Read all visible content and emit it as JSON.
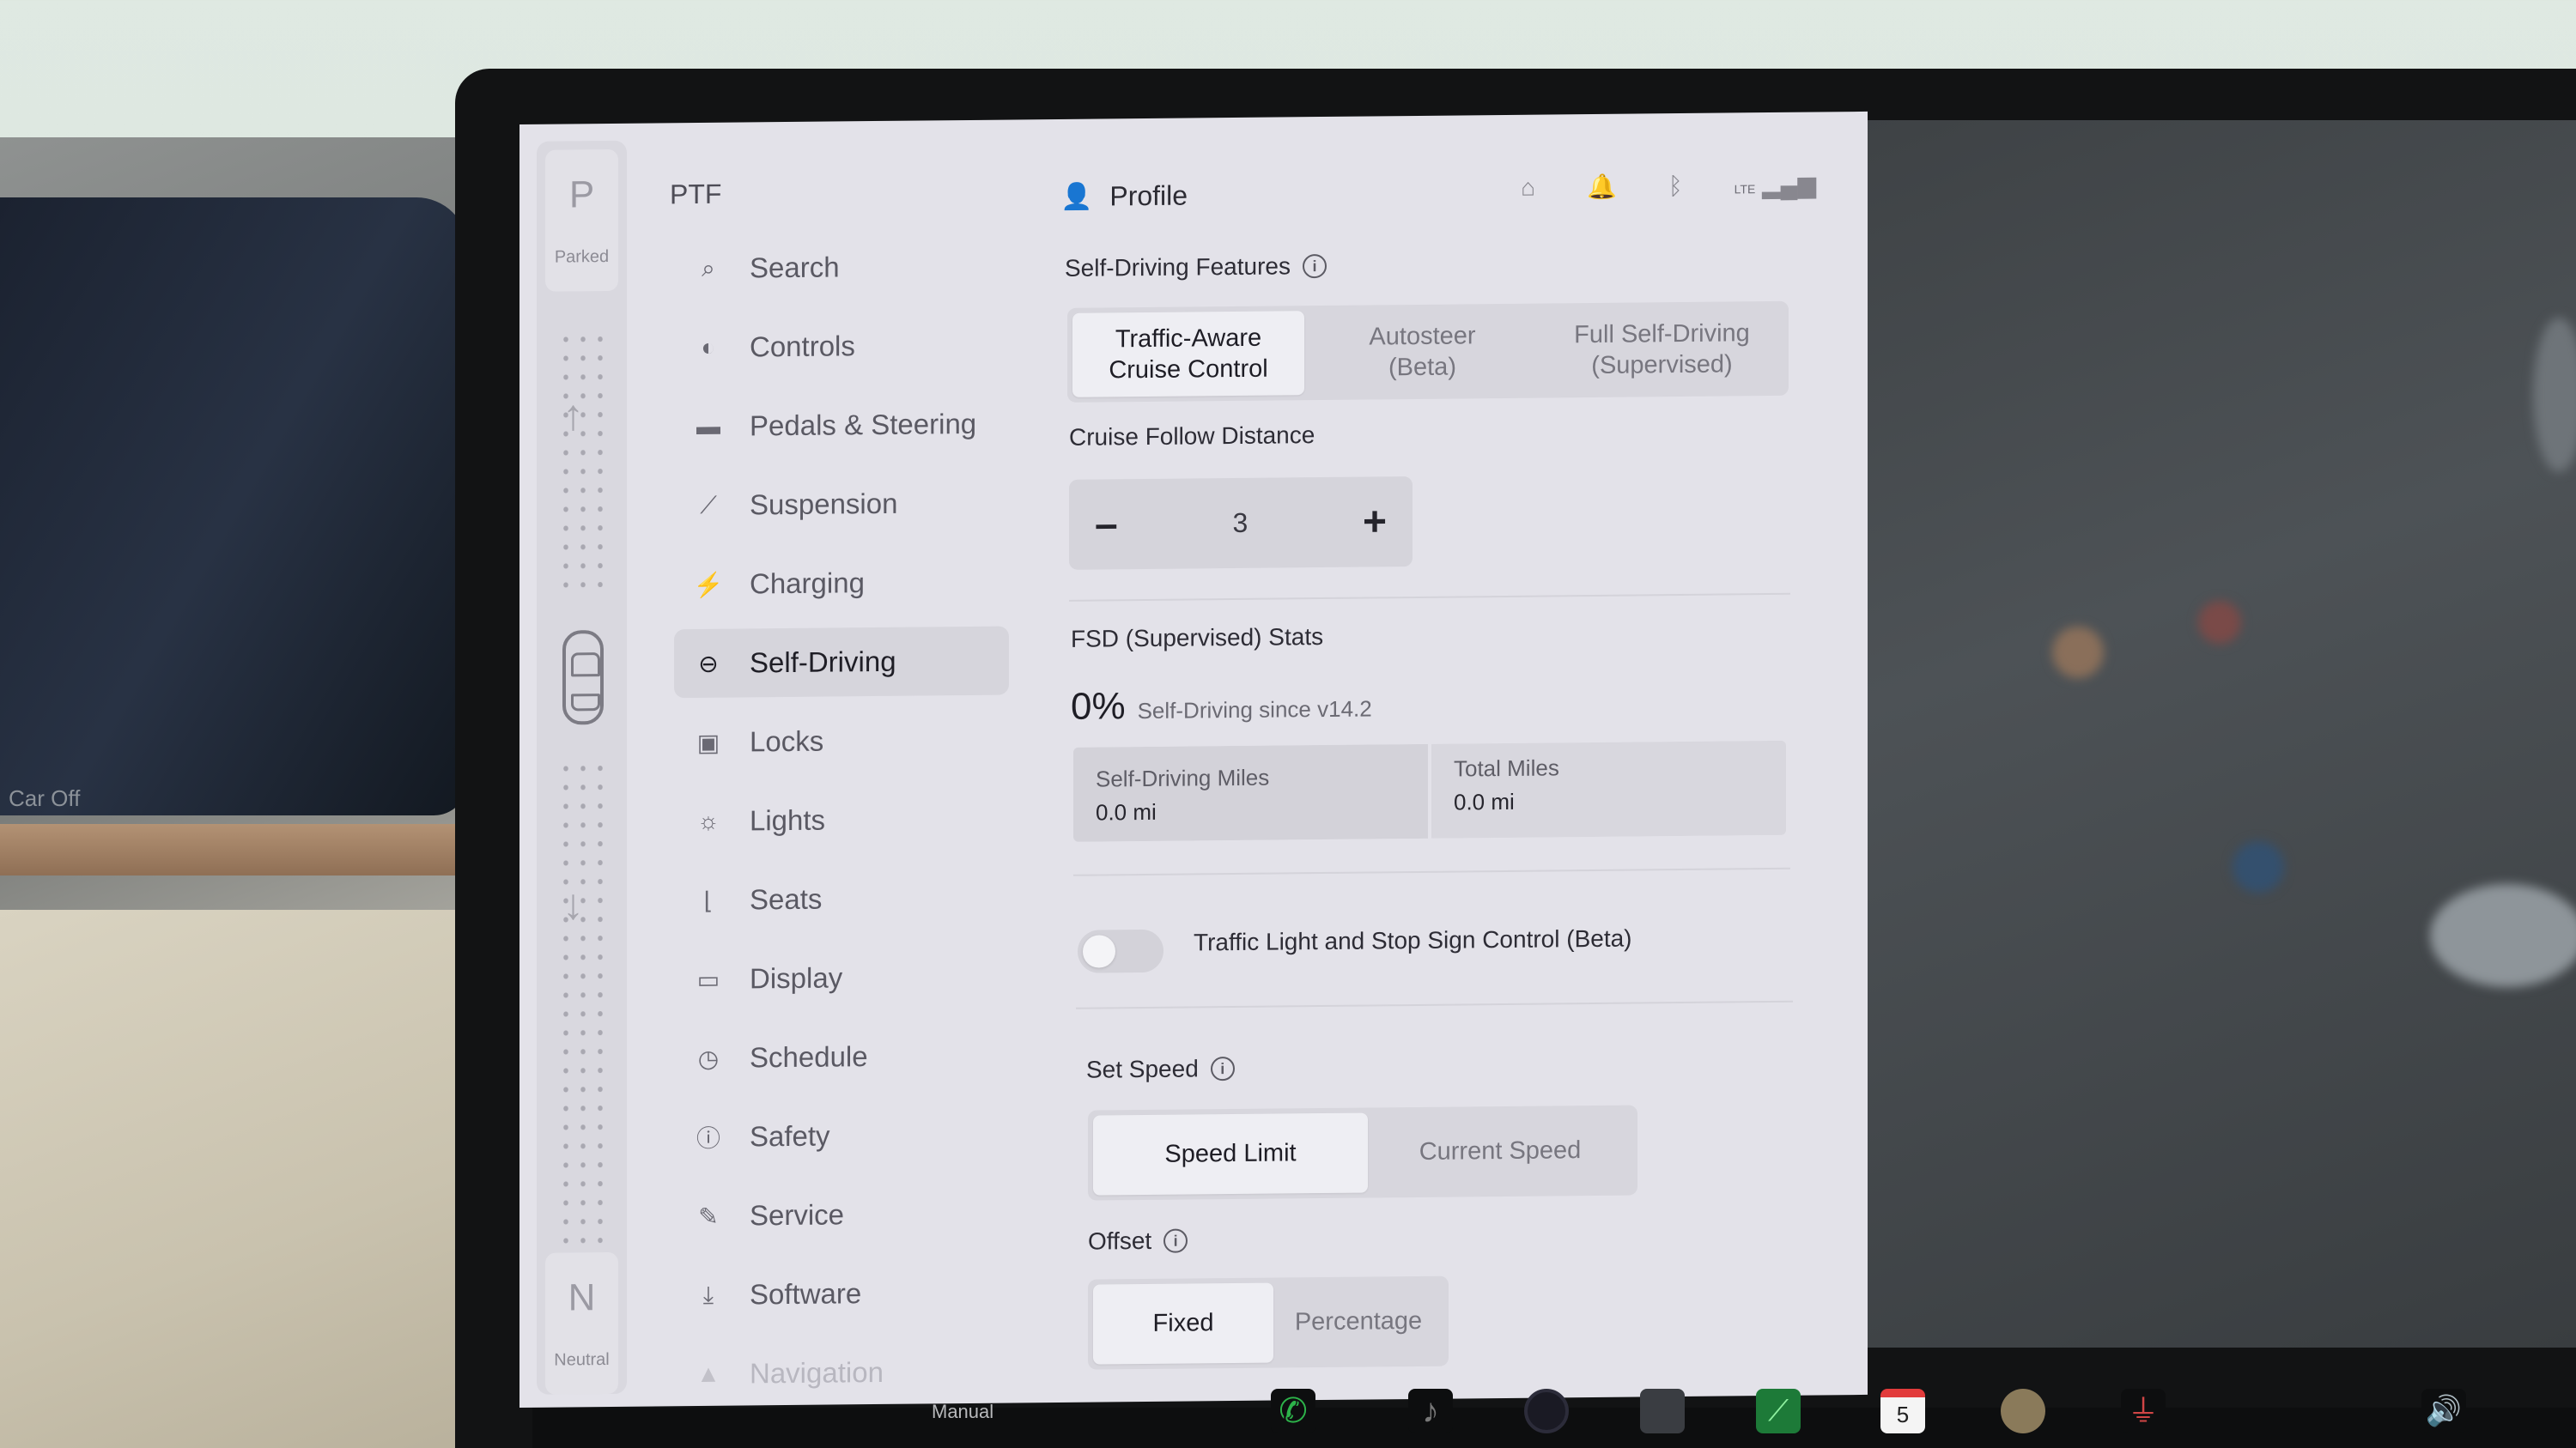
{
  "gear": {
    "top_letter": "P",
    "top_label": "Parked",
    "bottom_letter": "N",
    "bottom_label": "Neutral"
  },
  "cluster_text": "Car Off",
  "sidebar": {
    "title": "PTF",
    "items": [
      {
        "label": "Search",
        "icon": "search-icon",
        "glyph": "⌕"
      },
      {
        "label": "Controls",
        "icon": "toggle-icon",
        "glyph": "◐"
      },
      {
        "label": "Pedals & Steering",
        "icon": "car-icon",
        "glyph": "▬"
      },
      {
        "label": "Suspension",
        "icon": "wrench-icon",
        "glyph": "⟋"
      },
      {
        "label": "Charging",
        "icon": "bolt-icon",
        "glyph": "⚡"
      },
      {
        "label": "Self-Driving",
        "icon": "steering-wheel-icon",
        "glyph": "⊖",
        "active": true
      },
      {
        "label": "Locks",
        "icon": "lock-icon",
        "glyph": "🔒"
      },
      {
        "label": "Lights",
        "icon": "sun-icon",
        "glyph": "☼"
      },
      {
        "label": "Seats",
        "icon": "seat-icon",
        "glyph": "⌊"
      },
      {
        "label": "Display",
        "icon": "display-icon",
        "glyph": "▭"
      },
      {
        "label": "Schedule",
        "icon": "clock-icon",
        "glyph": "◷"
      },
      {
        "label": "Safety",
        "icon": "alert-icon",
        "glyph": "ⓘ"
      },
      {
        "label": "Service",
        "icon": "tool-icon",
        "glyph": "✎"
      },
      {
        "label": "Software",
        "icon": "download-icon",
        "glyph": "⤓"
      },
      {
        "label": "Navigation",
        "icon": "navigation-icon",
        "glyph": "▲",
        "faded": true
      }
    ]
  },
  "header": {
    "profile_label": "Profile",
    "status": {
      "lte": "LTE"
    }
  },
  "self_driving": {
    "features_label": "Self-Driving Features",
    "features": [
      {
        "label": "Traffic-Aware\nCruise Control",
        "selected": true
      },
      {
        "label": "Autosteer\n(Beta)",
        "selected": false
      },
      {
        "label": "Full Self-Driving\n(Supervised)",
        "selected": false
      }
    ],
    "follow_distance_label": "Cruise Follow Distance",
    "follow_distance_minus": "–",
    "follow_distance_value": "3",
    "follow_distance_plus": "+",
    "stats_label": "FSD (Supervised) Stats",
    "stats_percent": "0%",
    "stats_since": "Self-Driving since v14.2",
    "self_driving_miles_label": "Self-Driving Miles",
    "self_driving_miles_value": "0.0 mi",
    "total_miles_label": "Total Miles",
    "total_miles_value": "0.0 mi",
    "traffic_light_label": "Traffic Light and Stop Sign Control (Beta)",
    "traffic_light_enabled": false,
    "set_speed_label": "Set Speed",
    "set_speed_options": [
      {
        "label": "Speed Limit",
        "selected": true
      },
      {
        "label": "Current Speed",
        "selected": false
      }
    ],
    "offset_label": "Offset",
    "offset_options": [
      {
        "label": "Fixed",
        "selected": true
      },
      {
        "label": "Percentage",
        "selected": false
      }
    ]
  },
  "taskbar": {
    "mode_label": "Manual",
    "calendar_day": "5"
  },
  "colors": {
    "screen_bg": "#e3e2e9",
    "active_item_bg": "#d6d5dc",
    "segment_selected": "#eeeef3"
  }
}
